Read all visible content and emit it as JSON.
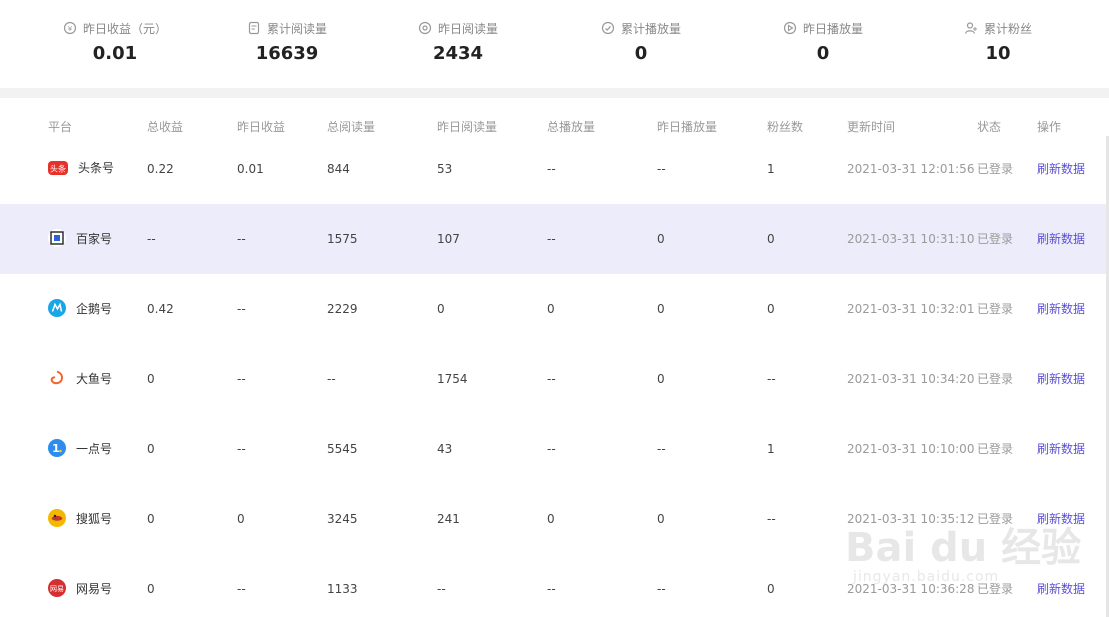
{
  "stats": [
    {
      "label": "昨日收益（元）",
      "value": "0.01",
      "icon": "coin-icon"
    },
    {
      "label": "累计阅读量",
      "value": "16639",
      "icon": "document-icon"
    },
    {
      "label": "昨日阅读量",
      "value": "2434",
      "icon": "eye-icon"
    },
    {
      "label": "累计播放量",
      "value": "0",
      "icon": "play-circle-icon"
    },
    {
      "label": "昨日播放量",
      "value": "0",
      "icon": "play-icon"
    },
    {
      "label": "累计粉丝",
      "value": "10",
      "icon": "user-plus-icon"
    }
  ],
  "table": {
    "columns": [
      "平台",
      "总收益",
      "昨日收益",
      "总阅读量",
      "昨日阅读量",
      "总播放量",
      "昨日播放量",
      "粉丝数",
      "更新时间",
      "状态",
      "操作"
    ],
    "rows": [
      {
        "platform": "头条号",
        "icon": "toutiao-icon",
        "icon_color": "#e6322a",
        "total_income": "0.22",
        "yesterday_income": "0.01",
        "total_reads": "844",
        "yesterday_reads": "53",
        "total_plays": "--",
        "yesterday_plays": "--",
        "fans": "1",
        "updated": "2021-03-31 12:01:56",
        "status": "已登录",
        "action": "刷新数据"
      },
      {
        "platform": "百家号",
        "icon": "baijia-icon",
        "icon_color": "#2b2b2b",
        "total_income": "--",
        "yesterday_income": "--",
        "total_reads": "1575",
        "yesterday_reads": "107",
        "total_plays": "--",
        "yesterday_plays": "0",
        "fans": "0",
        "updated": "2021-03-31 10:31:10",
        "status": "已登录",
        "action": "刷新数据"
      },
      {
        "platform": "企鹅号",
        "icon": "qie-icon",
        "icon_color": "#1aa6e6",
        "total_income": "0.42",
        "yesterday_income": "--",
        "total_reads": "2229",
        "yesterday_reads": "0",
        "total_plays": "0",
        "yesterday_plays": "0",
        "fans": "0",
        "updated": "2021-03-31 10:32:01",
        "status": "已登录",
        "action": "刷新数据"
      },
      {
        "platform": "大鱼号",
        "icon": "dayu-icon",
        "icon_color": "#f0642d",
        "total_income": "0",
        "yesterday_income": "--",
        "total_reads": "--",
        "yesterday_reads": "1754",
        "total_plays": "--",
        "yesterday_plays": "0",
        "fans": "--",
        "updated": "2021-03-31 10:34:20",
        "status": "已登录",
        "action": "刷新数据"
      },
      {
        "platform": "一点号",
        "icon": "yidian-icon",
        "icon_color": "#2d8cf0",
        "total_income": "0",
        "yesterday_income": "--",
        "total_reads": "5545",
        "yesterday_reads": "43",
        "total_plays": "--",
        "yesterday_plays": "--",
        "fans": "1",
        "updated": "2021-03-31 10:10:00",
        "status": "已登录",
        "action": "刷新数据"
      },
      {
        "platform": "搜狐号",
        "icon": "sohu-icon",
        "icon_color": "#f5b800",
        "total_income": "0",
        "yesterday_income": "0",
        "total_reads": "3245",
        "yesterday_reads": "241",
        "total_plays": "0",
        "yesterday_plays": "0",
        "fans": "--",
        "updated": "2021-03-31 10:35:12",
        "status": "已登录",
        "action": "刷新数据"
      },
      {
        "platform": "网易号",
        "icon": "wangyi-icon",
        "icon_color": "#d62f2f",
        "total_income": "0",
        "yesterday_income": "--",
        "total_reads": "1133",
        "yesterday_reads": "--",
        "total_plays": "--",
        "yesterday_plays": "--",
        "fans": "0",
        "updated": "2021-03-31 10:36:28",
        "status": "已登录",
        "action": "刷新数据"
      }
    ]
  },
  "watermark": {
    "main": "Bai du 经验",
    "sub": "jingyan.baidu.com"
  }
}
